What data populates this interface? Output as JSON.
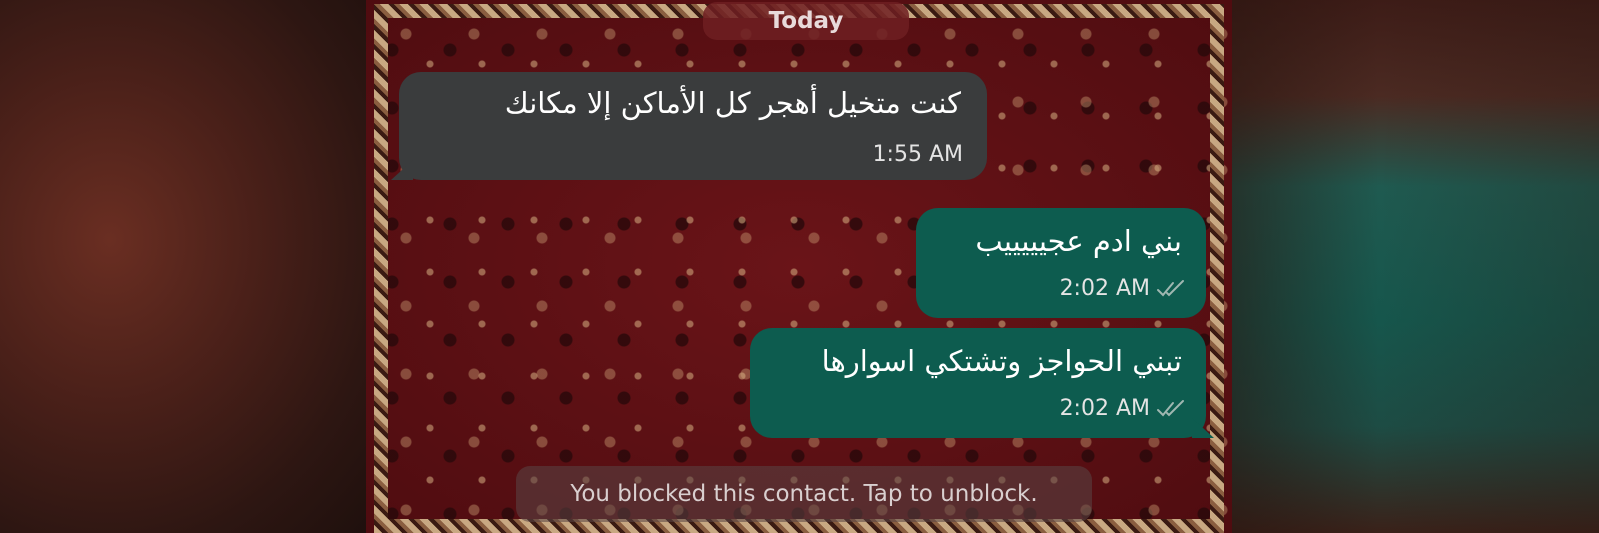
{
  "date_chip": "Today",
  "messages": [
    {
      "direction": "incoming",
      "text": "كنت متخيل أهجر كل الأماكن إلا مكانك",
      "time": "1:55 AM"
    },
    {
      "direction": "outgoing",
      "text": "بني ادم عجيييييب",
      "time": "2:02 AM",
      "status": "read"
    },
    {
      "direction": "outgoing",
      "text": "تبني الحواجز وتشتكي اسوارها",
      "time": "2:02 AM",
      "status": "read"
    }
  ],
  "blocked_banner": "You blocked this contact. Tap to unblock.",
  "colors": {
    "incoming_bubble": "#3a3c3d",
    "outgoing_bubble": "#0d5c4f",
    "read_ticks": "#9fb7b1",
    "wallpaper": "#5a0f12"
  },
  "icons": {
    "read_status": "double-check-icon"
  }
}
